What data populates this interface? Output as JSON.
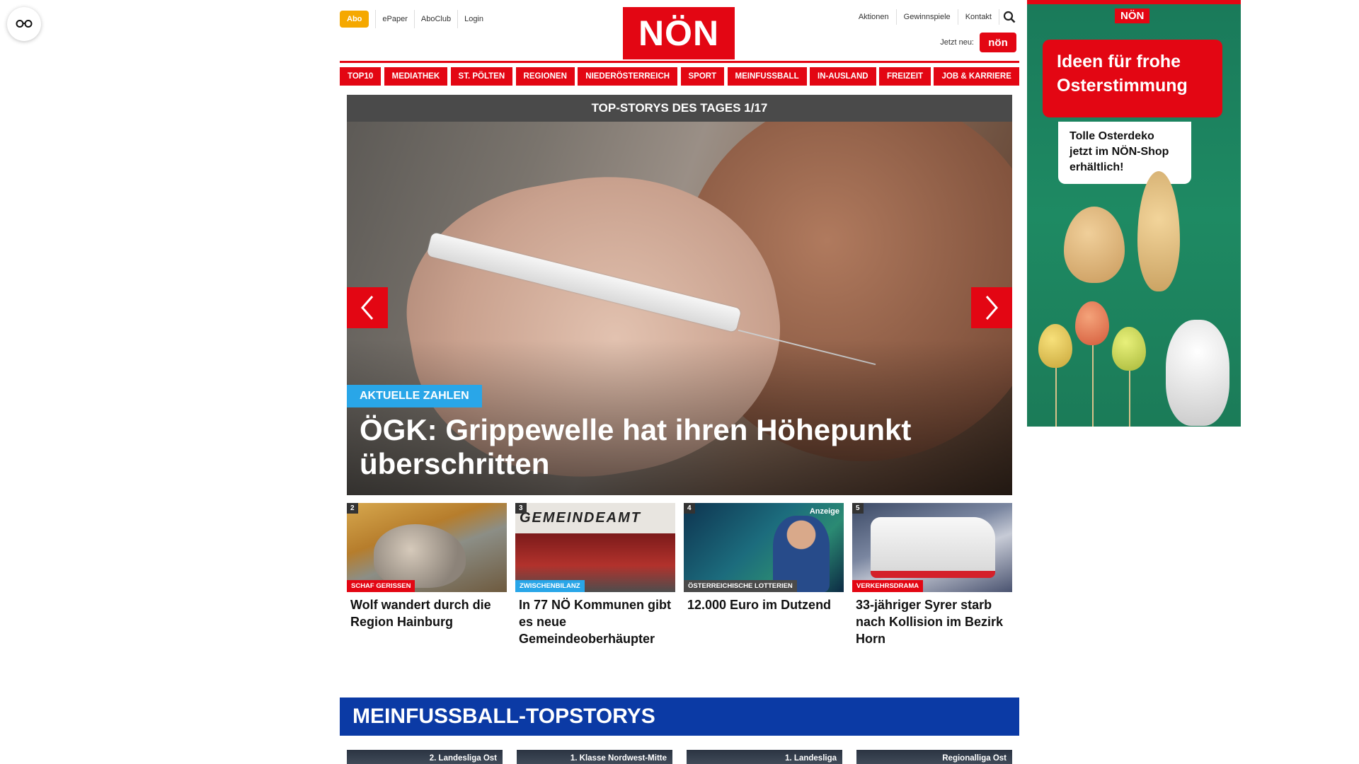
{
  "header": {
    "abo": "Abo",
    "left_links": [
      "ePaper",
      "AboClub",
      "Login"
    ],
    "logo": "NÖN",
    "right_links": [
      "Aktionen",
      "Gewinnspiele",
      "Kontakt"
    ],
    "jetzt_label": "Jetzt neu:",
    "jetzt_badge": "nön"
  },
  "nav": [
    "TOP10",
    "MEDIATHEK",
    "ST. PÖLTEN",
    "REGIONEN",
    "NIEDERÖSTERREICH",
    "SPORT",
    "MEINFUSSBALL",
    "IN-AUSLAND",
    "FREIZEIT",
    "JOB & KARRIERE"
  ],
  "hero": {
    "bar": "TOP-STORYS DES TAGES 1/17",
    "tag": "AKTUELLE ZAHLEN",
    "title": "ÖGK: Grippewelle hat ihren Höhepunkt überschritten"
  },
  "stories": [
    {
      "num": "2",
      "tag": "SCHAF GERISSEN",
      "tag_color": "#e30613",
      "title": "Wolf wandert durch die Region Hainburg"
    },
    {
      "num": "3",
      "tag": "ZWISCHENBILANZ",
      "tag_color": "#29a6e8",
      "title": "In 77 NÖ Kommunen gibt es neue Gemeindeoberhäupter",
      "sign": "GEMEINDEAMT"
    },
    {
      "num": "4",
      "tag": "ÖSTERREICHISCHE LOTTERIEN",
      "tag_color": "#4a4a4a",
      "title": "12.000 Euro im Dutzend",
      "anzeige": "Anzeige"
    },
    {
      "num": "5",
      "tag": "VERKEHRSDRAMA",
      "tag_color": "#e30613",
      "title": "33-jähriger Syrer starb nach Kollision im Bezirk Horn"
    }
  ],
  "football": {
    "title": "MEINFUSSBALL-TOPSTORYS",
    "cards": [
      "2. Landesliga Ost",
      "1. Klasse Nordwest-Mitte",
      "1. Landesliga",
      "Regionalliga Ost"
    ]
  },
  "ad": {
    "logo": "NÖN",
    "headline": "Ideen für frohe Osterstimmung",
    "note": "Tolle Osterdeko jetzt im NÖN-Shop erhältlich!"
  },
  "colors": {
    "brand_red": "#e30613",
    "abo_orange": "#f5a800",
    "football_blue": "#0b3aa5",
    "tag_blue": "#29a6e8"
  },
  "icons": {
    "reader": "glasses-icon",
    "search": "search-icon",
    "prev": "chevron-left-icon",
    "next": "chevron-right-icon"
  }
}
